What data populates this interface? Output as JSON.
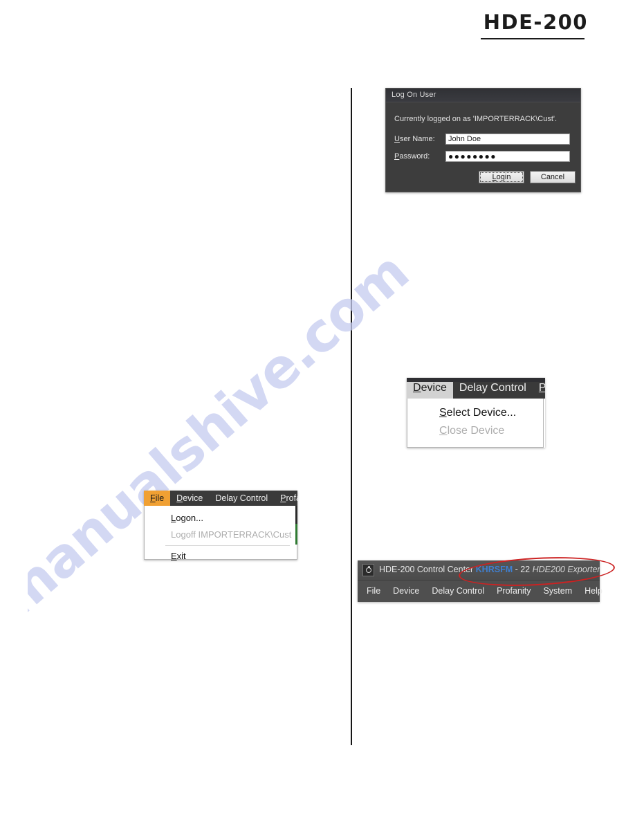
{
  "page": {
    "model_header": "HDE-200",
    "watermark": "manualshive.com"
  },
  "logon_dialog": {
    "title": "Log On User",
    "status_text": "Currently logged on as 'IMPORTERRACK\\Cust'.",
    "fields": {
      "username": {
        "label_pre": "U",
        "label_post": "ser Name:",
        "value": "John Doe"
      },
      "password": {
        "label_pre": "P",
        "label_post": "assword:",
        "value": "●●●●●●●●"
      }
    },
    "buttons": {
      "login_pre": "L",
      "login_post": "ogin",
      "cancel": "Cancel"
    }
  },
  "file_menu": {
    "menubar": [
      {
        "label": "File",
        "acc_pre": "F",
        "acc_post": "ile",
        "state": "active-orange"
      },
      {
        "label": "Device",
        "acc_pre": "D",
        "acc_post": "evice",
        "state": ""
      },
      {
        "label": "Delay Control",
        "acc_pre": "De",
        "acc_post": "lay Control",
        "state": ""
      },
      {
        "label": "Profanity",
        "acc_pre": "P",
        "acc_post": "rofanity",
        "state": ""
      }
    ],
    "items": [
      {
        "label": "Logon...",
        "acc_pre": "L",
        "acc_post": "ogon...",
        "disabled": false
      },
      {
        "label": "Logoff IMPORTERRACK\\Cust",
        "acc_pre": "Logo",
        "acc_post": "ff IMPORTERRACK\\Cust",
        "disabled": true
      },
      {
        "separator": true
      },
      {
        "label": "Exit",
        "acc_pre": "E",
        "acc_post": "xit",
        "disabled": false
      }
    ]
  },
  "device_menu": {
    "menubar": [
      {
        "label": "Device",
        "acc_pre": "D",
        "acc_post": "evice",
        "state": "active-gray"
      },
      {
        "label": "Delay Control",
        "acc_pre": "De",
        "acc_post": "lay Control",
        "state": ""
      },
      {
        "label": "P",
        "acc_pre": "P",
        "acc_post": "",
        "state": ""
      }
    ],
    "items": [
      {
        "label": "Select Device...",
        "acc_pre": "S",
        "acc_post": "elect Device...",
        "disabled": false
      },
      {
        "label": "Close Device",
        "acc_pre": "C",
        "acc_post": "lose Device",
        "disabled": true
      }
    ]
  },
  "control_center": {
    "title_prefix": "HDE-200 Control Center ",
    "callsign": "KHRSFM",
    "title_middle": " - 22 ",
    "title_italic": "HDE200 Exporter",
    "menubar": [
      "File",
      "Device",
      "Delay Control",
      "Profanity",
      "System",
      "Help"
    ],
    "annotation_color": "#cc2222"
  }
}
